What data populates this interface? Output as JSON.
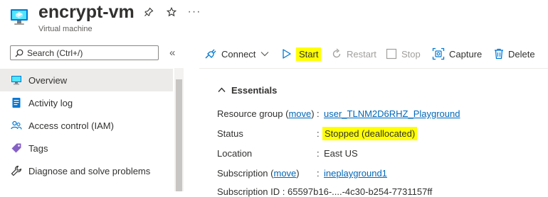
{
  "header": {
    "title": "encrypt-vm",
    "subtitle": "Virtual machine",
    "pin_icon": "pin-icon",
    "favorite_icon": "star-icon",
    "more_label": "···"
  },
  "sidebar": {
    "search_placeholder": "Search (Ctrl+/)",
    "collapse_label": "«",
    "items": [
      {
        "label": "Overview",
        "icon": "monitor-icon",
        "selected": true
      },
      {
        "label": "Activity log",
        "icon": "activity-log-icon",
        "selected": false
      },
      {
        "label": "Access control (IAM)",
        "icon": "people-icon",
        "selected": false
      },
      {
        "label": "Tags",
        "icon": "tag-icon",
        "selected": false
      },
      {
        "label": "Diagnose and solve problems",
        "icon": "wrench-icon",
        "selected": false
      }
    ]
  },
  "toolbar": {
    "connect": "Connect",
    "start": "Start",
    "restart": "Restart",
    "stop": "Stop",
    "capture": "Capture",
    "delete": "Delete"
  },
  "essentials": {
    "title": "Essentials",
    "rows": [
      {
        "label": "Resource group",
        "label_link": "move",
        "value": "user_TLNM2D6RHZ_Playground",
        "value_is_link": true
      },
      {
        "label": "Status",
        "value": "Stopped (deallocated)",
        "highlight": true
      },
      {
        "label": "Location",
        "value": "East US"
      },
      {
        "label": "Subscription",
        "label_link": "move",
        "value": "ineplayground1",
        "value_is_link": true
      }
    ],
    "partial_row": "Subscription ID               :  65597b16-....-4c30-b254-7731157ff"
  },
  "colors": {
    "accent": "#0078d4",
    "link": "#0067b8",
    "highlight": "#ffff00",
    "selected_bg": "#edebe9"
  }
}
